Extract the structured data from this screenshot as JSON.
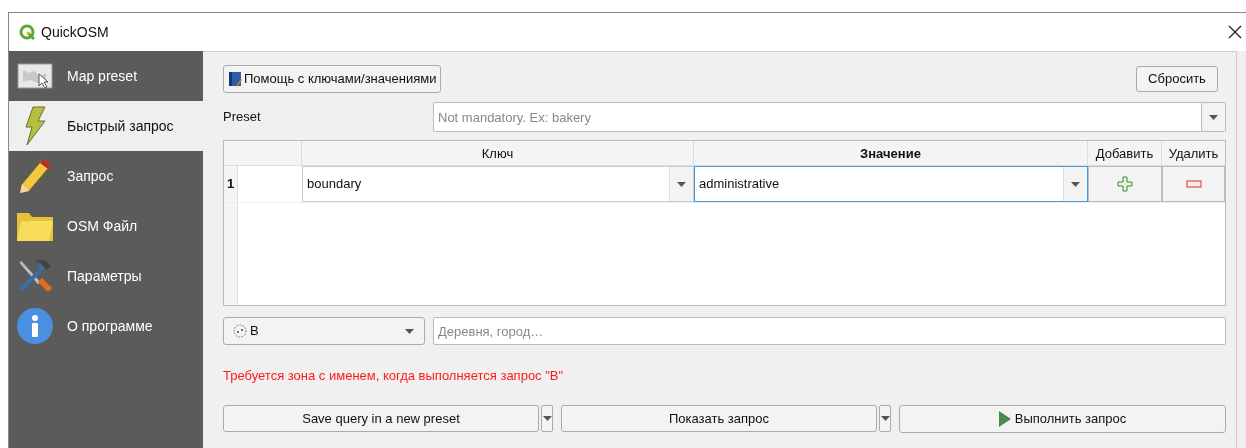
{
  "window": {
    "title": "QuickOSM"
  },
  "sidebar": {
    "items": [
      {
        "label": "Map preset",
        "kind": "map",
        "selected": false
      },
      {
        "label": "Быстрый запрос",
        "kind": "bolt",
        "selected": true
      },
      {
        "label": "Запрос",
        "kind": "pencil",
        "selected": false
      },
      {
        "label": "OSM Файл",
        "kind": "folder",
        "selected": false
      },
      {
        "label": "Параметры",
        "kind": "tools",
        "selected": false
      },
      {
        "label": "О программе",
        "kind": "info",
        "selected": false
      }
    ]
  },
  "help_button": "Помощь с ключами/значениями",
  "reset_button": "Сбросить",
  "preset": {
    "label": "Preset",
    "placeholder": "Not mandatory. Ex: bakery"
  },
  "table": {
    "columns": [
      "Ключ",
      "Значение",
      "Добавить",
      "Удалить"
    ],
    "rows": [
      {
        "index": "1",
        "key": "boundary",
        "value": "administrative"
      }
    ]
  },
  "area_type": {
    "value": "В"
  },
  "place": {
    "placeholder": "Деревня, город…"
  },
  "error": "Требуется зона с именем, когда выполняется запрос \"В\"",
  "buttons": [
    {
      "label": "Save query in a new preset",
      "kind": "split"
    },
    {
      "label": "Показать запрос",
      "kind": "split"
    },
    {
      "label": "Выполнить запрос",
      "kind": "run"
    }
  ]
}
